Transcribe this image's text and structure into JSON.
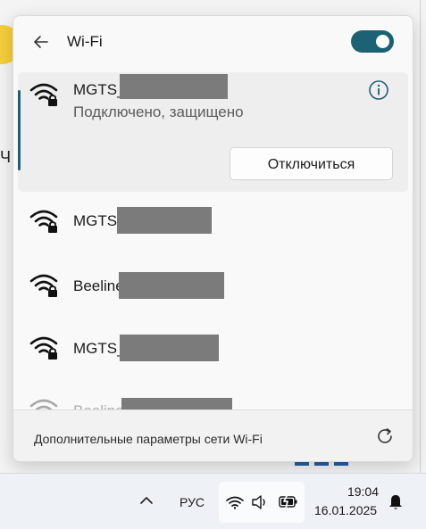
{
  "flyout": {
    "title": "Wi-Fi",
    "wifi_enabled": true,
    "connected_network": {
      "ssid_prefix": "MGTS_",
      "status": "Подключено, защищено",
      "disconnect_label": "Отключиться"
    },
    "networks": [
      {
        "ssid_prefix": "MGTS_"
      },
      {
        "ssid_prefix": "Beeline"
      },
      {
        "ssid_prefix": "MGTS_"
      },
      {
        "ssid_prefix": "Beeline"
      }
    ],
    "more_settings": "Дополнительные параметры сети Wi-Fi"
  },
  "background": {
    "char": "Ч"
  },
  "taskbar": {
    "language": "РУС",
    "time": "19:04",
    "date": "16.01.2025"
  },
  "colors": {
    "accent": "#1d6175"
  }
}
